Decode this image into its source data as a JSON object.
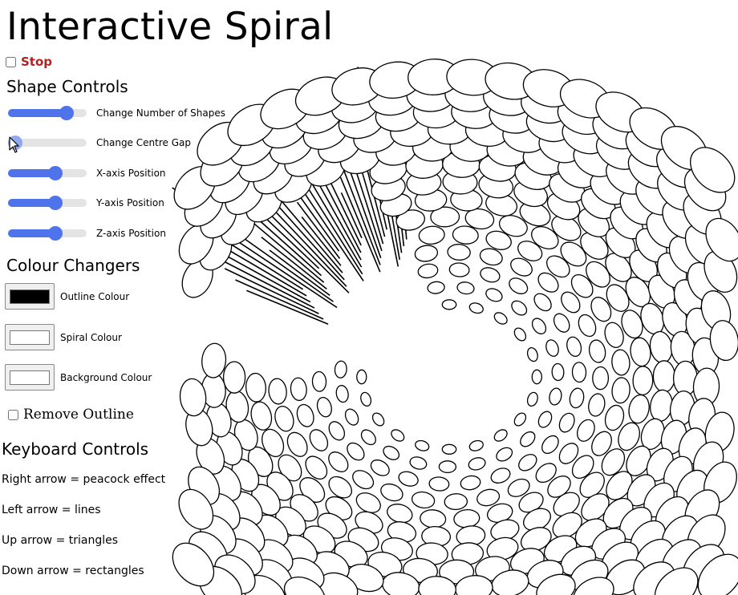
{
  "page": {
    "title": "Interactive Spiral",
    "stop": {
      "label": "Stop",
      "checked": false,
      "color": "#b22222"
    }
  },
  "shape_controls": {
    "heading": "Shape Controls",
    "sliders": [
      {
        "label": "Change Number of Shapes",
        "value": 0.8
      },
      {
        "label": "Change Centre Gap",
        "value": 0.0
      },
      {
        "label": "X-axis Position",
        "value": 0.62
      },
      {
        "label": "Y-axis Position",
        "value": 0.62
      },
      {
        "label": "Z-axis Position",
        "value": 0.62
      }
    ]
  },
  "colour_changers": {
    "heading": "Colour Changers",
    "pickers": [
      {
        "label": "Outline Colour",
        "color": "#000000"
      },
      {
        "label": "Spiral Colour",
        "color": "#ffffff"
      },
      {
        "label": "Background Colour",
        "color": "#ffffff"
      }
    ],
    "remove_outline": {
      "label": "Remove Outline",
      "checked": false
    }
  },
  "keyboard_controls": {
    "heading": "Keyboard Controls",
    "lines": [
      "Right arrow = peacock effect",
      "Left arrow = lines",
      "Up arrow = triangles",
      "Down arrow = rectangles"
    ]
  },
  "theme": {
    "slider_accent": "#4e73ea",
    "slider_track": "#e4e4e4",
    "spiral_fill": "#ffffff",
    "spiral_stroke": "#000000",
    "background": "#ffffff"
  },
  "icons": {
    "cursor": "mouse-pointer-icon"
  }
}
